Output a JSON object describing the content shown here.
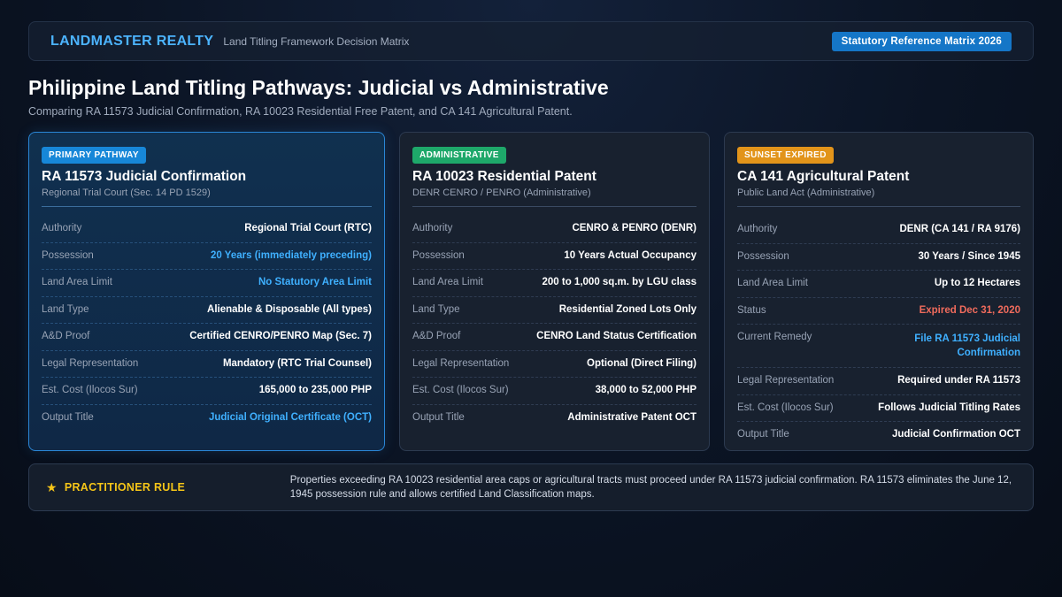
{
  "header": {
    "brand": "LANDMASTER REALTY",
    "subtitle": "Land Titling Framework Decision Matrix",
    "badge": "Statutory Reference Matrix 2026"
  },
  "title": "Philippine Land Titling Pathways: Judicial vs Administrative",
  "subtitle": "Comparing RA 11573 Judicial Confirmation, RA 10023 Residential Free Patent, and CA 141 Agricultural Patent.",
  "cards": [
    {
      "tag": "PRIMARY PATHWAY",
      "title": "RA 11573 Judicial Confirmation",
      "subtitle": "Regional Trial Court (Sec. 14 PD 1529)",
      "rows": [
        {
          "label": "Authority",
          "value": "Regional Trial Court (RTC)"
        },
        {
          "label": "Possession",
          "value": "20 Years (immediately preceding)"
        },
        {
          "label": "Land Area Limit",
          "value": "No Statutory Area Limit"
        },
        {
          "label": "Land Type",
          "value": "Alienable & Disposable (All types)"
        },
        {
          "label": "A&D Proof",
          "value": "Certified CENRO/PENRO Map (Sec. 7)"
        },
        {
          "label": "Legal Representation",
          "value": "Mandatory (RTC Trial Counsel)"
        },
        {
          "label": "Est. Cost (Ilocos Sur)",
          "value": "165,000 to 235,000 PHP"
        },
        {
          "label": "Output Title",
          "value": "Judicial Original Certificate (OCT)"
        }
      ]
    },
    {
      "tag": "ADMINISTRATIVE",
      "title": "RA 10023 Residential Patent",
      "subtitle": "DENR CENRO / PENRO (Administrative)",
      "rows": [
        {
          "label": "Authority",
          "value": "CENRO & PENRO (DENR)"
        },
        {
          "label": "Possession",
          "value": "10 Years Actual Occupancy"
        },
        {
          "label": "Land Area Limit",
          "value": "200 to 1,000 sq.m. by LGU class"
        },
        {
          "label": "Land Type",
          "value": "Residential Zoned Lots Only"
        },
        {
          "label": "A&D Proof",
          "value": "CENRO Land Status Certification"
        },
        {
          "label": "Legal Representation",
          "value": "Optional (Direct Filing)"
        },
        {
          "label": "Est. Cost (Ilocos Sur)",
          "value": "38,000 to 52,000 PHP"
        },
        {
          "label": "Output Title",
          "value": "Administrative Patent OCT"
        }
      ]
    },
    {
      "tag": "SUNSET EXPIRED",
      "title": "CA 141 Agricultural Patent",
      "subtitle": "Public Land Act (Administrative)",
      "rows": [
        {
          "label": "Authority",
          "value": "DENR (CA 141 / RA 9176)"
        },
        {
          "label": "Possession",
          "value": "30 Years / Since 1945"
        },
        {
          "label": "Land Area Limit",
          "value": "Up to 12 Hectares"
        },
        {
          "label": "Status",
          "value": "Expired Dec 31, 2020"
        },
        {
          "label": "Current Remedy",
          "value": "File RA 11573 Judicial Confirmation"
        },
        {
          "label": "Legal Representation",
          "value": "Required under RA 11573"
        },
        {
          "label": "Est. Cost (Ilocos Sur)",
          "value": "Follows Judicial Titling Rates"
        },
        {
          "label": "Output Title",
          "value": "Judicial Confirmation OCT"
        }
      ]
    }
  ],
  "rule": {
    "label": "PRACTITIONER RULE",
    "text": "Properties exceeding RA 10023 residential area caps or agricultural tracts must proceed under RA 11573 judicial confirmation. RA 11573 eliminates the June 12, 1945 possession rule and allows certified Land Classification maps."
  },
  "colors": {
    "brand": "#4cb4ff",
    "accent_blue": "#1787d8",
    "accent_green": "#1ea86a",
    "accent_orange": "#e2941a",
    "highlight_blue": "#3fb0ff",
    "alert_red": "#f06b5c",
    "rule_yellow": "#f5c518"
  },
  "icons": {
    "rule": "star-icon"
  }
}
